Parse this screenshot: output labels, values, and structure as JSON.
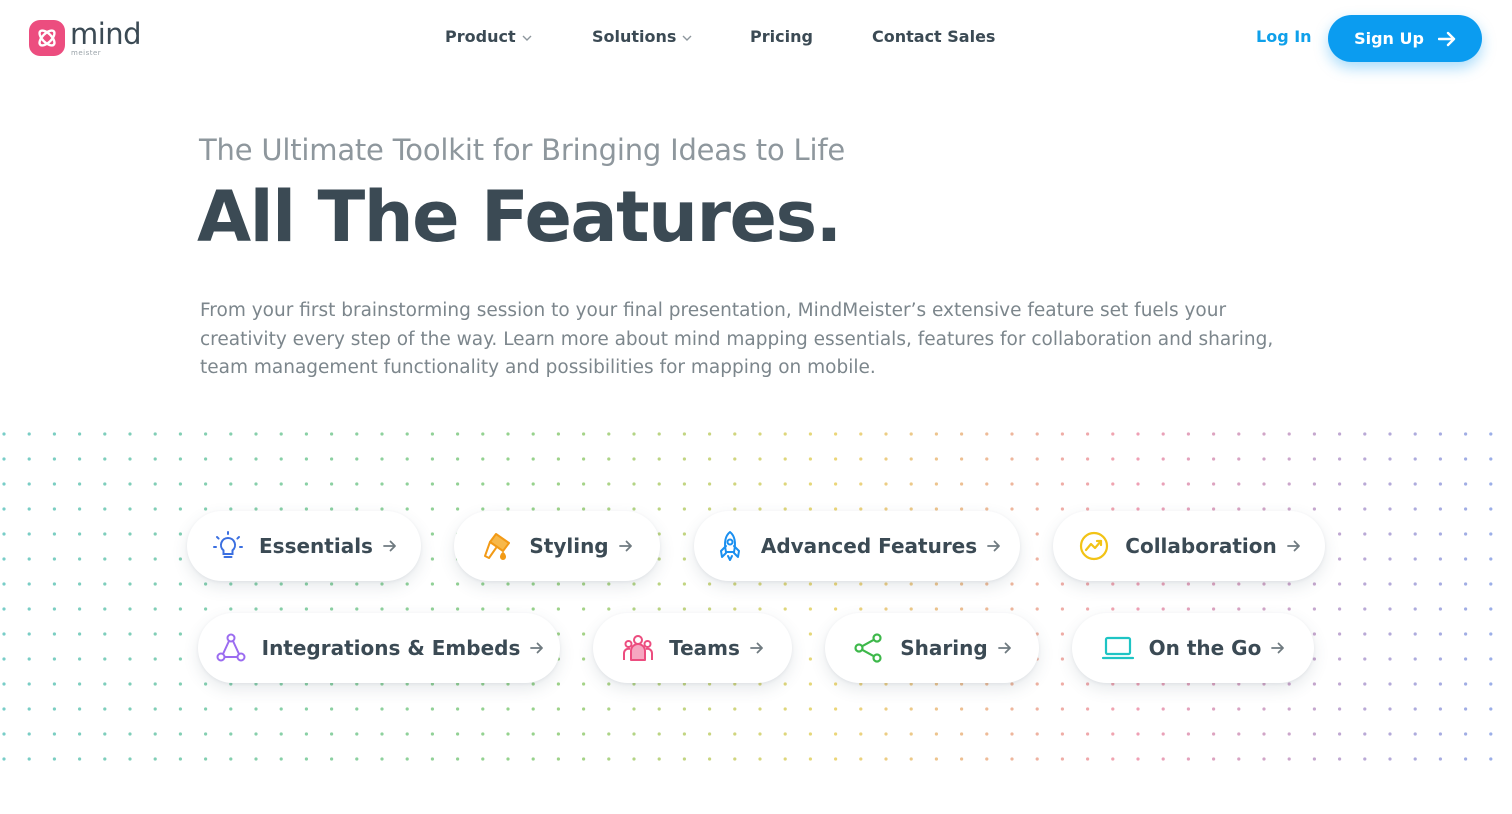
{
  "header": {
    "logo": {
      "word": "mind",
      "sub": "meister"
    },
    "nav": [
      {
        "label": "Product",
        "has_dropdown": true
      },
      {
        "label": "Solutions",
        "has_dropdown": true
      },
      {
        "label": "Pricing",
        "has_dropdown": false
      },
      {
        "label": "Contact Sales",
        "has_dropdown": false
      }
    ],
    "login_label": "Log In",
    "signup_label": "Sign Up"
  },
  "hero": {
    "kicker": "The Ultimate Toolkit for Bringing Ideas to Life",
    "headline": "All The Features.",
    "intro": "From your first brainstorming session to your final presentation, MindMeister’s extensive feature set fuels your creativity every step of the way. Learn more about mind mapping essentials, features for collaboration and sharing, team management functionality and possibilities for mapping on mobile."
  },
  "features": [
    {
      "label": "Essentials",
      "icon": "lightbulb-icon",
      "color": "#3b6fe0"
    },
    {
      "label": "Styling",
      "icon": "paint-bucket-icon",
      "color": "#f29a16"
    },
    {
      "label": "Advanced Features",
      "icon": "rocket-icon",
      "color": "#1a8ff0"
    },
    {
      "label": "Collaboration",
      "icon": "trending-circle-icon",
      "color": "#f2c316"
    },
    {
      "label": "Integrations & Embeds",
      "icon": "nodes-icon",
      "color": "#9b6cf0"
    },
    {
      "label": "Teams",
      "icon": "team-icon",
      "color": "#ec4d7f"
    },
    {
      "label": "Sharing",
      "icon": "share-icon",
      "color": "#3db84a"
    },
    {
      "label": "On the Go",
      "icon": "laptop-icon",
      "color": "#1ec4c4"
    }
  ],
  "colors": {
    "text": "#3b4a54",
    "muted": "#8e979d",
    "accent": "#0b9cf0",
    "brand": "#ec4d7f"
  }
}
